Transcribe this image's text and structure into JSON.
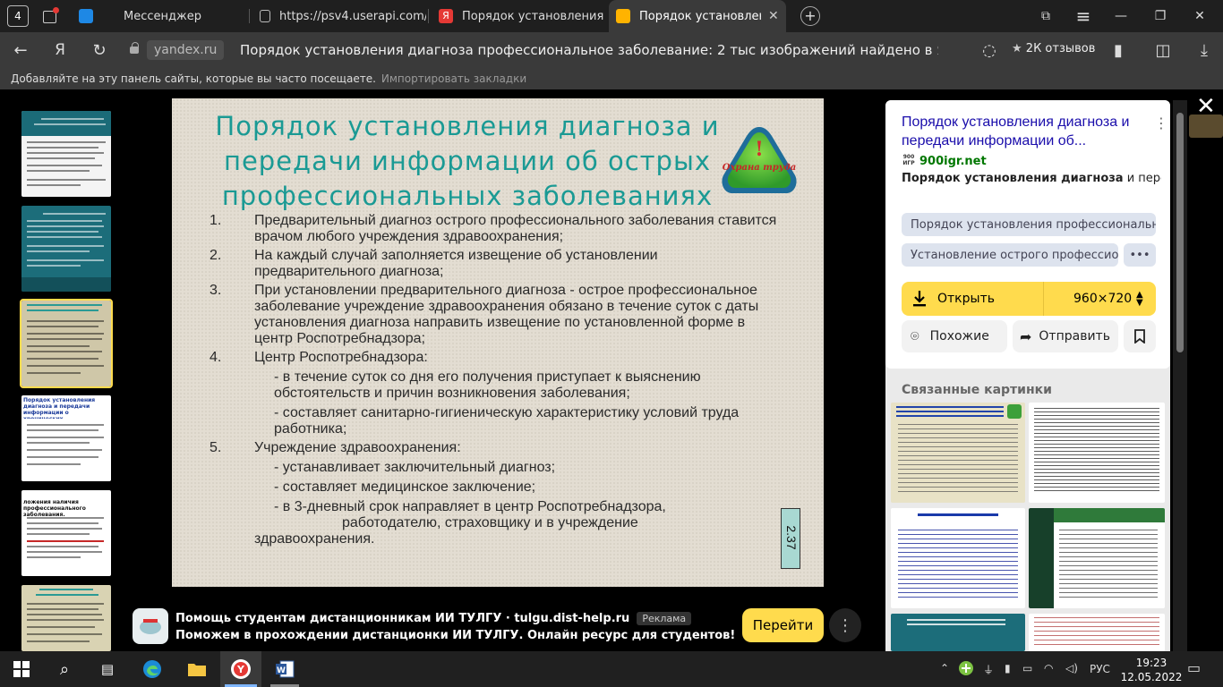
{
  "tabs": {
    "count": "4",
    "items": [
      {
        "label": "Мессенджер",
        "fav_color": "#1e88e5"
      },
      {
        "label": "https://psv4.userapi.com/c",
        "fav_color": "#888888"
      },
      {
        "label": "Порядок установления ди",
        "fav_color": "#e53935"
      },
      {
        "label": "Порядок установления",
        "fav_color": "#ffb300"
      }
    ]
  },
  "address": {
    "domain": "yandex.ru",
    "title": "Порядок установления диагноза профессиональное заболевание: 2 тыс изображений найдено в Яндек...",
    "reviews": "2К отзывов",
    "star": "★"
  },
  "bookmarks": {
    "text": "Добавляйте на эту панель сайты, которые вы часто посещаете.",
    "import": "Импортировать закладки"
  },
  "slide": {
    "title": "Порядок установления диагноза и передачи информации об острых профессиональных заболеваниях",
    "logo_text": "Охрана труда",
    "logo_mark": "!",
    "items": [
      {
        "num": "1.",
        "text": "Предварительный диагноз острого профессионального заболевания ставится врачом любого учреждения здравоохранения;"
      },
      {
        "num": "2.",
        "text": "На каждый случай заполняется извещение об установлении предварительного диагноза;"
      },
      {
        "num": "3.",
        "text": "При установлении предварительного диагноза - острое профессиональное заболевание учреждение здравоохранения обязано в течение суток с даты установления диагноза направить извещение по установленной форме в центр Роспотребнадзора;"
      },
      {
        "num": "4.",
        "text": "Центр Роспотребнадзора:"
      },
      {
        "num": "5.",
        "text": "Учреждение здравоохранения:"
      }
    ],
    "sub4": [
      "-   в течение суток со дня его получения приступает к выяснению обстоятельств и причин возникновения заболевания;",
      "- составляет санитарно-гигиеническую характеристику условий труда работника;"
    ],
    "sub5": [
      "- устанавливает заключительный диагноз;",
      "- составляет медицинское заключение;",
      "- в 3-дневный срок направляет в центр Роспотребнадзора,"
    ],
    "sub5_cont": "работодателю, страховщику и в учреждение",
    "sub5_end": "здравоохранения.",
    "number": "2.37"
  },
  "thumbs": {
    "t4_title": "Порядок установления диагноза и передачи информации о хронических профессиональных заболеваний",
    "t5_title": "ложения наличия профессионального заболевания."
  },
  "ad": {
    "title": "Помощь студентам дистанционникам ИИ ТУЛГУ · tulgu.dist-help.ru",
    "badge": "Реклама",
    "text": "Поможем в прохождении дистанционки ИИ ТУЛГУ. Онлайн ресурс для студентов!",
    "button": "Перейти",
    "more": "⋮"
  },
  "panel": {
    "result_title": "Порядок установления диагноза и передачи информации об...",
    "site": "900igr.net",
    "site_fav": "900 ИГР",
    "snippet_bold": "Порядок установления диагноза",
    "snippet_rest": " и пере...",
    "chips": [
      "Порядок установления профессионально...",
      "Установление острого профессионально...",
      "•••"
    ],
    "open_label": "Открыть",
    "size": "960×720",
    "similar": "Похожие",
    "share": "Отправить",
    "related": "Связанные картинки"
  },
  "clock": {
    "time": "19:23",
    "date": "12.05.2022"
  },
  "tray": {
    "lang": "РУС"
  },
  "colors": {
    "accent": "#ffdb4d",
    "slide_title": "#1a9a94",
    "link": "#1a0dab",
    "teal_thumb": "#1b6b78"
  }
}
